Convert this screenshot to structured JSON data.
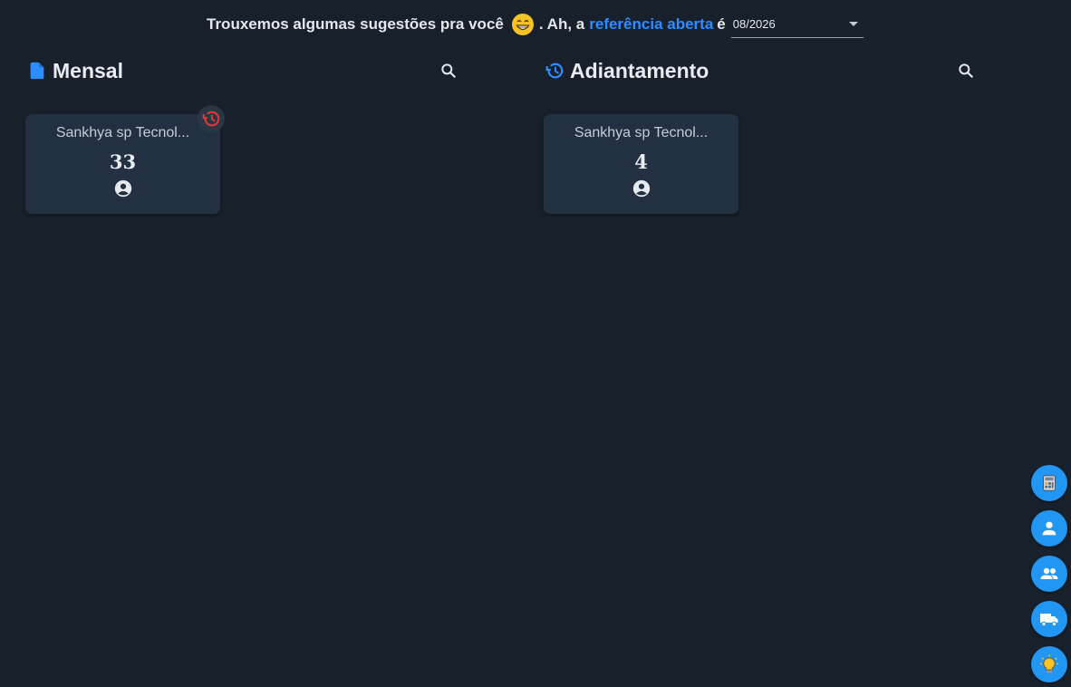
{
  "banner": {
    "prefix": "Trouxemos algumas sugestões pra você",
    "middle": ". Ah, a",
    "link": "referência aberta",
    "suffix": "é",
    "reference_value": "08/2026"
  },
  "sections": {
    "mensal": {
      "title": "Mensal",
      "icon": "document-icon",
      "cards": [
        {
          "company": "Sankhya sp Tecnol...",
          "count": "33"
        }
      ]
    },
    "adiantamento": {
      "title": "Adiantamento",
      "icon": "history-icon",
      "cards": [
        {
          "company": "Sankhya sp Tecnol...",
          "count": "4"
        }
      ]
    }
  },
  "fabs": [
    "calculator-icon",
    "person-icon",
    "people-icon",
    "truck-icon",
    "lightbulb-icon"
  ],
  "colors": {
    "background": "#18202b",
    "card": "#223041",
    "accent": "#2e8dff",
    "fab": "#2196f3",
    "alert": "#e53935"
  }
}
